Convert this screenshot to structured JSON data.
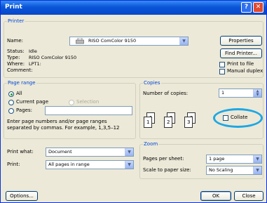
{
  "window": {
    "title": "Print"
  },
  "printer": {
    "group_label": "Printer",
    "name_label": "Name:",
    "name_value": "RISO ComColor 9150",
    "properties_label": "Properties",
    "status_label": "Status:",
    "status_value": "Idle",
    "type_label": "Type:",
    "type_value": "RISO ComColor 9150",
    "where_label": "Where:",
    "where_value": "LPT1:",
    "comment_label": "Comment:",
    "find_printer_label": "Find Printer...",
    "print_to_file_label": "Print to file",
    "manual_duplex_label": "Manual duplex"
  },
  "page_range": {
    "group_label": "Page range",
    "all_label": "All",
    "current_page_label": "Current page",
    "selection_label": "Selection",
    "pages_label": "Pages:",
    "hint": [
      "Enter page numbers and/or page ranges",
      "separated by commas. For example, 1,3,5–12"
    ]
  },
  "copies": {
    "group_label": "Copies",
    "number_label": "Number of copies:",
    "number_value": "1",
    "collate_label": "Collate",
    "page_numbers": [
      "1",
      "2",
      "3"
    ]
  },
  "print_what": {
    "label": "Print what:",
    "value": "Document"
  },
  "print": {
    "label": "Print:",
    "value": "All pages in range"
  },
  "zoom": {
    "group_label": "Zoom",
    "pages_per_sheet_label": "Pages per sheet:",
    "pages_per_sheet_value": "1 page",
    "scale_label": "Scale to paper size:",
    "scale_value": "No Scaling"
  },
  "buttons": {
    "options": "Options...",
    "ok": "OK",
    "close": "Close"
  },
  "colors": {
    "title_bar": "#0a55d8",
    "group_label": "#0046d5",
    "highlight_circle": "#1ea7e4"
  }
}
